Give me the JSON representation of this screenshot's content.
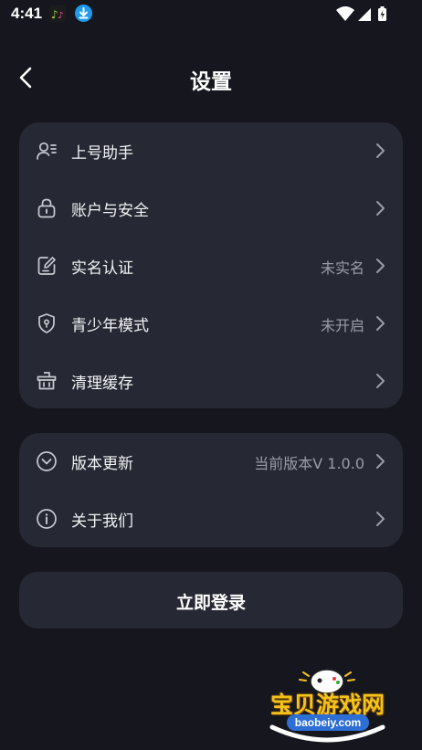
{
  "status_bar": {
    "time": "4:41",
    "app_icon": "app-icon",
    "download_icon": "download-icon",
    "indicators": [
      "wifi-icon",
      "signal-icon",
      "battery-icon"
    ]
  },
  "header": {
    "title": "设置"
  },
  "section1": [
    {
      "icon": "account-helper-icon",
      "label": "上号助手",
      "value": ""
    },
    {
      "icon": "lock-icon",
      "label": "账户与安全",
      "value": ""
    },
    {
      "icon": "edit-icon",
      "label": "实名认证",
      "value": "未实名"
    },
    {
      "icon": "shield-icon",
      "label": "青少年模式",
      "value": "未开启"
    },
    {
      "icon": "basket-icon",
      "label": "清理缓存",
      "value": ""
    }
  ],
  "section2": [
    {
      "icon": "chevron-circle-icon",
      "label": "版本更新",
      "value": "当前版本V 1.0.0"
    },
    {
      "icon": "info-icon",
      "label": "关于我们",
      "value": ""
    }
  ],
  "login": {
    "label": "立即登录"
  },
  "watermark": {
    "title": "宝贝游戏网",
    "url": "baobeiy.com"
  },
  "colors": {
    "background": "#16171e",
    "card": "#262933",
    "text_primary": "#f2f3f5",
    "text_secondary": "#9a9da6",
    "accent_download": "#1e9bf0"
  }
}
